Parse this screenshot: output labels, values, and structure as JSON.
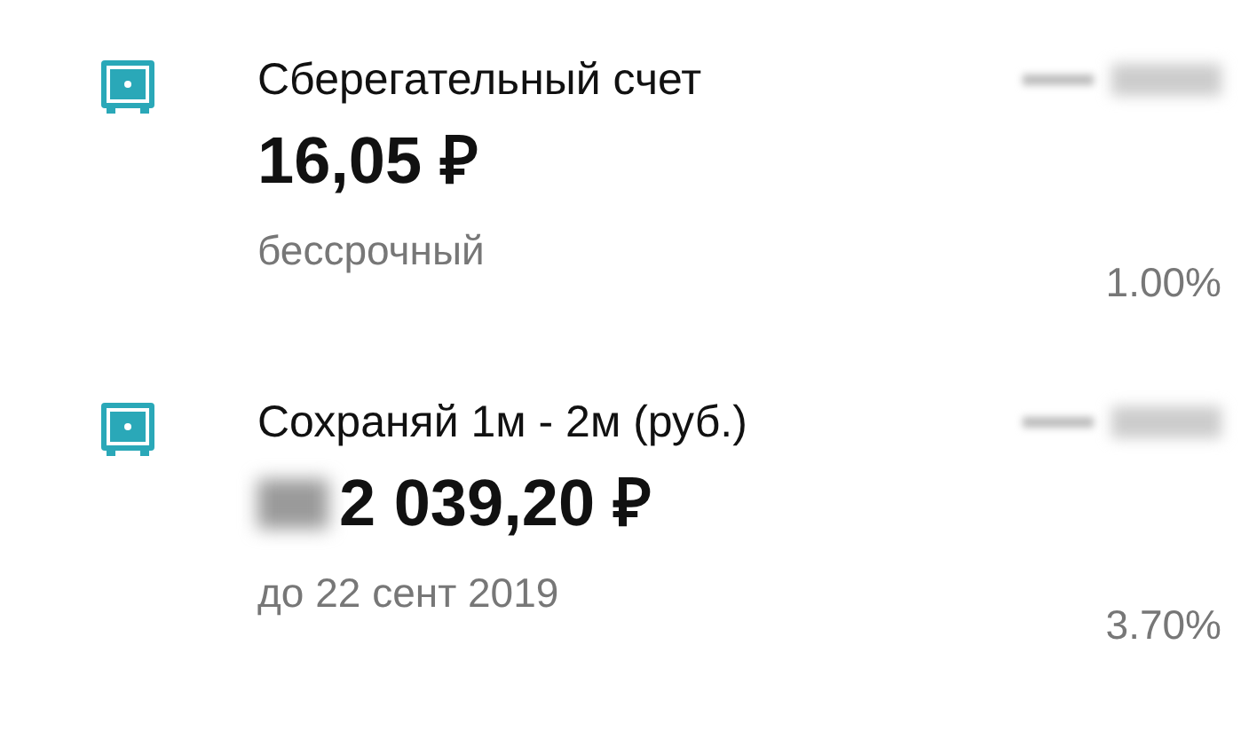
{
  "accounts": [
    {
      "name": "Сберегательный счет",
      "amount": "16,05 ₽",
      "amount_masked": false,
      "term": "бессрочный",
      "rate": "1.00%"
    },
    {
      "name": "Сохраняй 1м - 2м (руб.)",
      "amount": "2 039,20 ₽",
      "amount_masked": true,
      "term": "до 22 сент 2019",
      "rate": "3.70%"
    }
  ]
}
